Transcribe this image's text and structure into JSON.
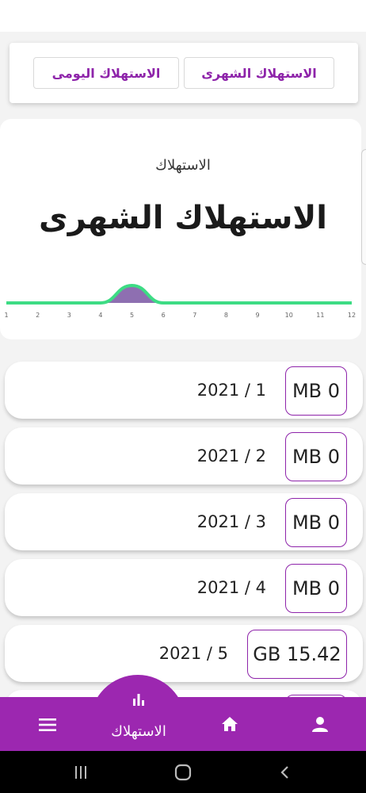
{
  "tabs": {
    "monthly_label": "الاستهلاك الشهرى",
    "daily_label": "الاستهلاك اليومى"
  },
  "chart": {
    "subtitle": "الاستهلاك",
    "title": "الاستهلاك الشهرى"
  },
  "chart_data": {
    "type": "area",
    "x": [
      1,
      2,
      3,
      4,
      5,
      6,
      7,
      8,
      9,
      10,
      11,
      12
    ],
    "categories": [
      "1",
      "2",
      "3",
      "4",
      "5",
      "6",
      "7",
      "8",
      "9",
      "10",
      "11",
      "12"
    ],
    "series": [
      {
        "values": [
          0,
          0,
          0,
          0,
          15.42,
          0,
          0,
          0,
          0,
          0,
          0,
          0
        ]
      }
    ],
    "xlabel": "",
    "ylabel": "",
    "grid": false,
    "colors": {
      "line": "#3ddc84",
      "fill": "#8e6fb1"
    }
  },
  "usage_rows": [
    {
      "date": "2021 / 1",
      "value": "MB 0"
    },
    {
      "date": "2021 / 2",
      "value": "MB 0"
    },
    {
      "date": "2021 / 3",
      "value": "MB 0"
    },
    {
      "date": "2021 / 4",
      "value": "MB 0"
    },
    {
      "date": "2021 / 5",
      "value": "GB 15.42"
    }
  ],
  "nav": {
    "active_label": "الاستهلاك",
    "items": [
      "menu-icon",
      "bar-chart-icon",
      "home-icon",
      "person-icon"
    ]
  },
  "colors": {
    "accent": "#9c27b0",
    "chart_line": "#3ddc84"
  }
}
